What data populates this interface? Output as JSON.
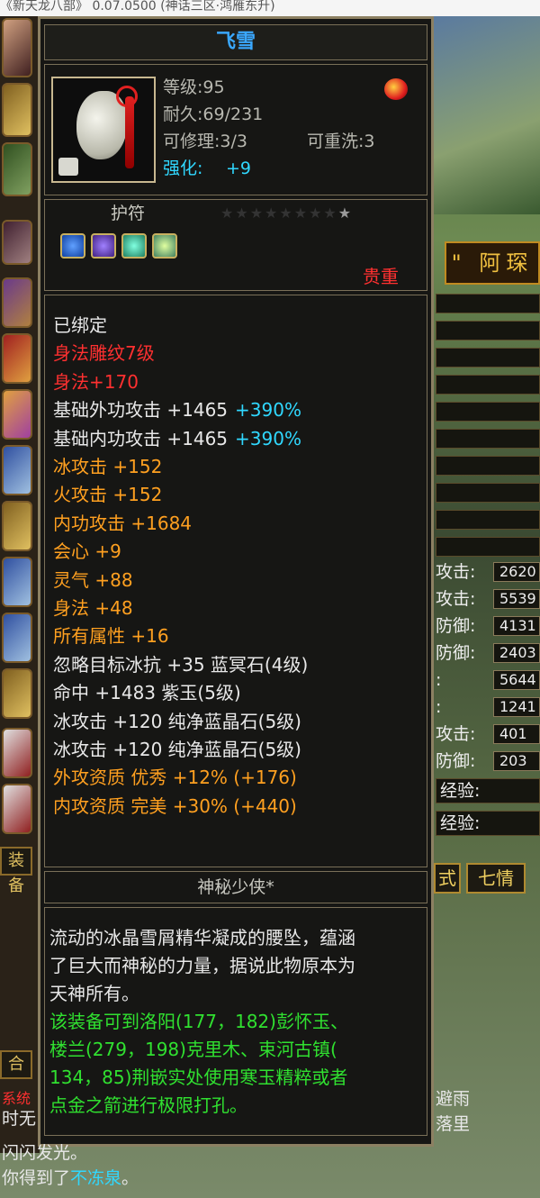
{
  "top_bar": {
    "text": "《新天龙八部》 0.07.0500 (神话三区·鸿雁东升)"
  },
  "tooltip": {
    "title": "飞雪",
    "level": "等级:95",
    "durability": "耐久:69/231",
    "repairable": "可修理:3/3",
    "rewashable": "可重洗:3",
    "enhance_label": "强化:",
    "enhance_value": "+9",
    "type": "护符",
    "stars_total": 9,
    "stars_lit": 1,
    "precious": "贵重",
    "attributes": [
      {
        "text": "已绑定",
        "color": "#e8e8e8"
      },
      {
        "text": "身法雕纹7级",
        "color": "#ff3030"
      },
      {
        "text": "身法+170",
        "color": "#ff3030"
      },
      {
        "text": "基础外功攻击 +1465",
        "extra": "+390%",
        "color": "#e8e8e8"
      },
      {
        "text": "基础内功攻击 +1465",
        "extra": "+390%",
        "color": "#e8e8e8"
      },
      {
        "text": "冰攻击 +152",
        "color": "#ffa020"
      },
      {
        "text": "火攻击 +152",
        "color": "#ffa020"
      },
      {
        "text": "内功攻击 +1684",
        "color": "#ffa020"
      },
      {
        "text": "会心 +9",
        "color": "#ffa020"
      },
      {
        "text": "灵气 +88",
        "color": "#ffa020"
      },
      {
        "text": "身法 +48",
        "color": "#ffa020"
      },
      {
        "text": "所有属性 +16",
        "color": "#ffa020"
      },
      {
        "text": "忽略目标冰抗 +35 蓝冥石(4级)",
        "color": "#e8e8e8"
      },
      {
        "text": "命中 +1483 紫玉(5级)",
        "color": "#e8e8e8"
      },
      {
        "text": "冰攻击 +120 纯净蓝晶石(5级)",
        "color": "#e8e8e8"
      },
      {
        "text": "冰攻击 +120 纯净蓝晶石(5级)",
        "color": "#e8e8e8"
      },
      {
        "text": "外攻资质  优秀 +12% (+176)",
        "color": "#ffa020"
      },
      {
        "text": "内攻资质  完美 +30% (+440)",
        "color": "#ffa020"
      }
    ],
    "mystery": "神秘少侠*",
    "description": [
      {
        "text": "流动的冰晶雪屑精华凝成的腰坠，蕴涵",
        "color": "#e8e8e8"
      },
      {
        "text": "了巨大而神秘的力量，据说此物原本为",
        "color": "#e8e8e8"
      },
      {
        "text": "天神所有。",
        "color": "#e8e8e8"
      },
      {
        "text": "该装备可到洛阳(177，182)彭怀玉、",
        "color": "#30e030"
      },
      {
        "text": "楼兰(279，198)克里木、束河古镇(",
        "color": "#30e030"
      },
      {
        "text": "134，85)荆嵌实处使用寒玉精粹或者",
        "color": "#30e030"
      },
      {
        "text": "点金之箭进行极限打孔。",
        "color": "#30e030"
      }
    ]
  },
  "right_panel": {
    "name": "\" 阿琛",
    "stats": [
      {
        "label": "攻击:",
        "value": "2620"
      },
      {
        "label": "攻击:",
        "value": "5539"
      },
      {
        "label": "防御:",
        "value": "4131"
      },
      {
        "label": "防御:",
        "value": "2403"
      },
      {
        "label": ":",
        "value": "5644"
      },
      {
        "label": ":",
        "value": "1241"
      },
      {
        "label": "攻击:",
        "value": "401"
      },
      {
        "label": "防御:",
        "value": "203"
      }
    ],
    "exp1": "经验:",
    "exp2": "经验:",
    "tab_left": "式",
    "tab_right": "七情",
    "chat1": "避雨",
    "chat2": "落里"
  },
  "left_panel": {
    "equip_btn": "装备",
    "merge_btn": "合",
    "chat_a": "系统",
    "chat_b": "时无"
  },
  "chat": {
    "line1": "闪闪发光。",
    "line2_prefix": "你得到了",
    "line2_item": "不冻泉",
    "line2_suffix": "。"
  }
}
